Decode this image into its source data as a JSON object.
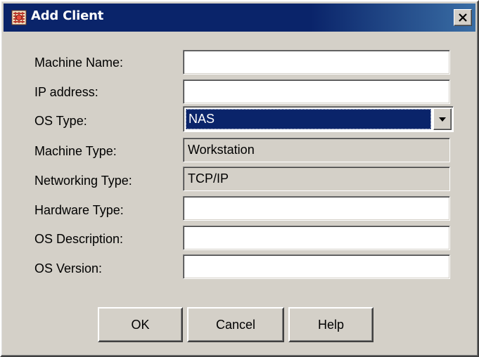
{
  "window": {
    "title": "Add Client"
  },
  "form": {
    "machine_name": {
      "label": "Machine Name:",
      "value": ""
    },
    "ip_address": {
      "label": "IP address:",
      "value": ""
    },
    "os_type": {
      "label": "OS Type:",
      "selected": "NAS"
    },
    "machine_type": {
      "label": "Machine Type:",
      "value": "Workstation"
    },
    "networking_type": {
      "label": "Networking Type:",
      "value": "TCP/IP"
    },
    "hardware_type": {
      "label": "Hardware Type:",
      "value": ""
    },
    "os_description": {
      "label": "OS Description:",
      "value": ""
    },
    "os_version": {
      "label": "OS Version:",
      "value": ""
    }
  },
  "buttons": {
    "ok": "OK",
    "cancel": "Cancel",
    "help": "Help"
  },
  "icons": {
    "app": "client-app-icon",
    "close": "close-icon",
    "dropdown": "chevron-down-icon"
  },
  "colors": {
    "titlebar": "#0a246a",
    "face": "#d4d0c8",
    "selection": "#0a246a"
  }
}
